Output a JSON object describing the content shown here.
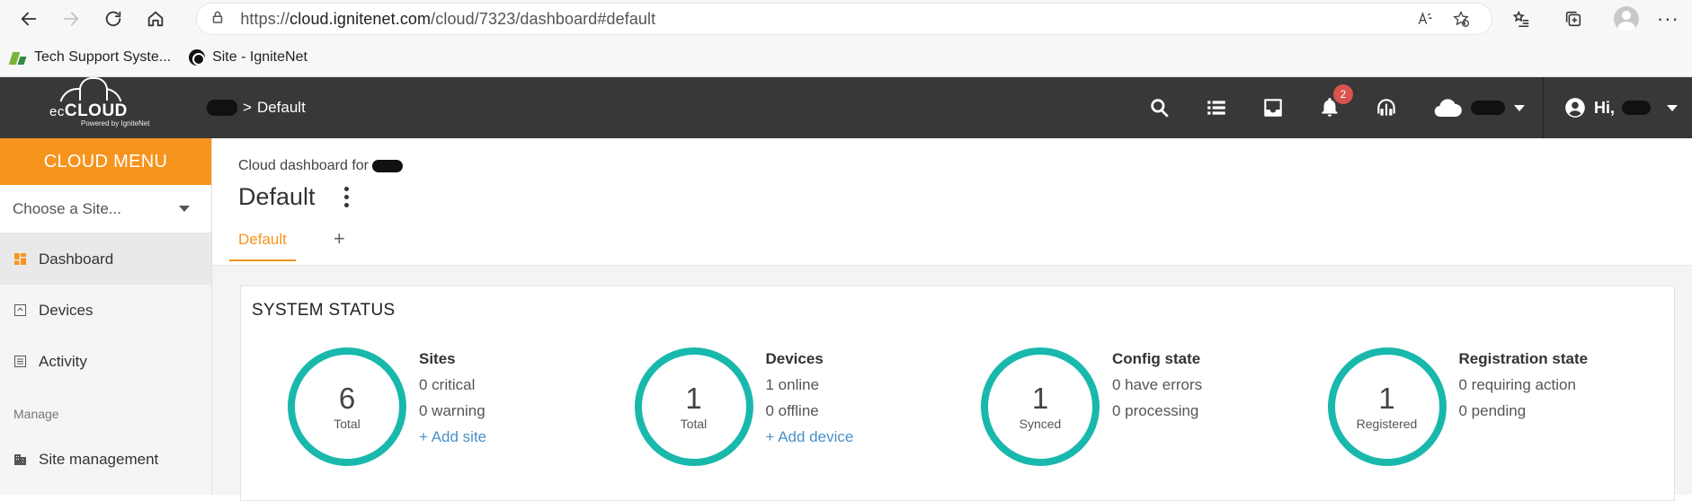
{
  "browser": {
    "url_prefix": "https://",
    "url_host": "cloud.ignitenet.com",
    "url_path": "/cloud/7323/dashboard#default",
    "bookmarks": [
      {
        "label": "Tech Support Syste..."
      },
      {
        "label": "Site - IgniteNet"
      }
    ]
  },
  "header": {
    "logo_ec": "ec",
    "logo_cloud": "CLOUD",
    "logo_powered": "Powered by IgniteNet",
    "breadcrumb_sep": ">",
    "breadcrumb_current": "Default",
    "notification_count": "2",
    "user_greeting": "Hi,"
  },
  "sidebar": {
    "menu_title": "CLOUD MENU",
    "site_chooser": "Choose a Site...",
    "items": [
      {
        "label": "Dashboard"
      },
      {
        "label": "Devices"
      },
      {
        "label": "Activity"
      }
    ],
    "section_label": "Manage",
    "manage_items": [
      {
        "label": "Site management"
      }
    ]
  },
  "main": {
    "subtitle": "Cloud dashboard for",
    "title": "Default",
    "tabs": [
      {
        "label": "Default"
      }
    ],
    "tab_add": "+",
    "card_title": "SYSTEM STATUS",
    "stats": [
      {
        "number": "6",
        "ring_label": "Total",
        "title": "Sites",
        "lines": [
          "0 critical",
          "0 warning"
        ],
        "link": "+ Add site"
      },
      {
        "number": "1",
        "ring_label": "Total",
        "title": "Devices",
        "lines": [
          "1 online",
          "0 offline"
        ],
        "link": "+ Add device"
      },
      {
        "number": "1",
        "ring_label": "Synced",
        "title": "Config state",
        "lines": [
          "0 have errors",
          "0 processing"
        ],
        "link": ""
      },
      {
        "number": "1",
        "ring_label": "Registered",
        "title": "Registration state",
        "lines": [
          "0 requiring action",
          "0 pending"
        ],
        "link": ""
      }
    ]
  },
  "colors": {
    "accent": "#f7941d",
    "ring": "#19b8ad",
    "header_bg": "#383838",
    "link": "#4a90c8",
    "badge": "#d9534f"
  }
}
